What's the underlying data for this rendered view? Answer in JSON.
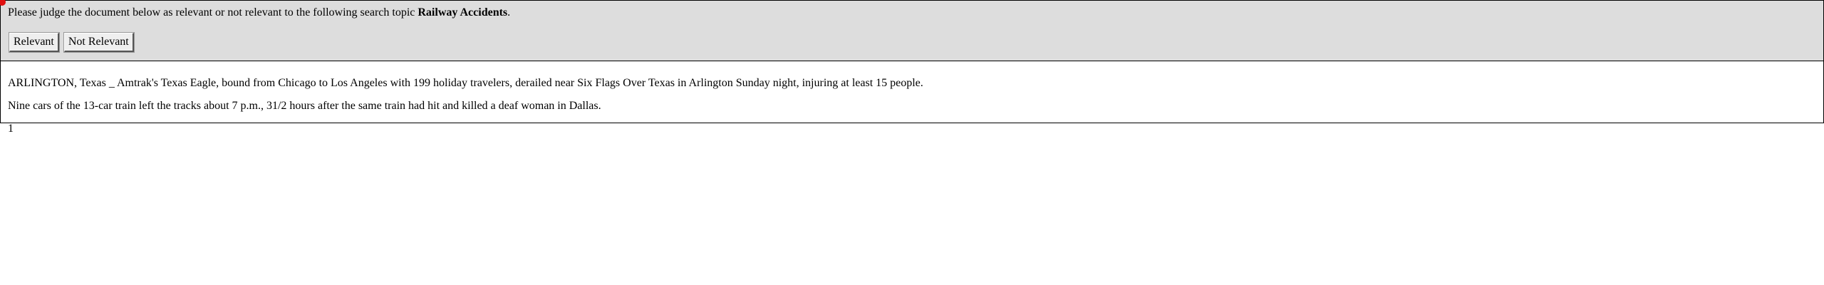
{
  "judge_bar": {
    "prompt_prefix": "Please judge the document below as relevant or not relevant to the following search topic ",
    "topic": "Railway Accidents",
    "prompt_suffix": ".",
    "relevant_label": "Relevant",
    "not_relevant_label": "Not Relevant"
  },
  "document": {
    "paragraphs": [
      "ARLINGTON, Texas _ Amtrak's Texas Eagle, bound from Chicago to Los Angeles with 199 holiday travelers, derailed near Six Flags Over Texas in Arlington Sunday night, injuring at least 15 people.",
      "Nine cars of the 13-car train left the tracks about 7 p.m., 31/2 hours after the same train had hit and killed a deaf woman in Dallas.",
      "1"
    ]
  },
  "colors": {
    "header_bg": "#dddddd",
    "border": "#000000",
    "cursor_dot": "#e01010"
  }
}
